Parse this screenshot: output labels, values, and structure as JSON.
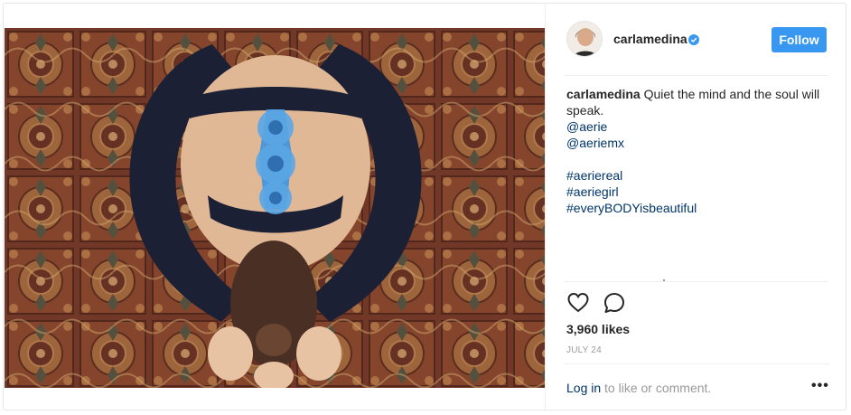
{
  "post": {
    "image_alt": "",
    "header": {
      "username": "carlamedina",
      "follow_label": "Follow",
      "verified_icon": "verified-badge-icon",
      "colors": {
        "follow_bg": "#3897f0",
        "verified": "#3897f0"
      }
    },
    "caption": {
      "username": "carlamedina",
      "text": "Quiet the mind and the soul will speak.",
      "mentions": [
        "@aerie",
        "@aeriemx"
      ],
      "hashtags": [
        "#aeriereal",
        "#aeriegirl",
        "#everyBODYisbeautiful"
      ],
      "link_color": "#003569"
    },
    "actions": {
      "like_icon": "heart-icon",
      "comment_icon": "comment-bubble-icon"
    },
    "likes": "3,960 likes",
    "date": "JULY 24",
    "comment_prompt": {
      "login": "Log in",
      "rest": " to like or comment."
    },
    "more_icon": "ellipsis-icon",
    "more_label": "•••"
  }
}
